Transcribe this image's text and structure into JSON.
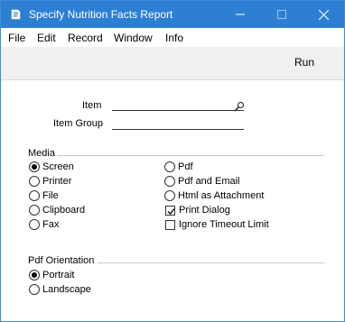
{
  "window": {
    "title": "Specify Nutrition Facts Report"
  },
  "menu": {
    "items": [
      "File",
      "Edit",
      "Record",
      "Window",
      "Info"
    ]
  },
  "toolbar": {
    "run_label": "Run"
  },
  "fields": {
    "item_label": "Item",
    "item_value": "",
    "item_group_label": "Item Group",
    "item_group_value": ""
  },
  "media": {
    "title": "Media",
    "left_options": [
      {
        "label": "Screen",
        "selected": true
      },
      {
        "label": "Printer",
        "selected": false
      },
      {
        "label": "File",
        "selected": false
      },
      {
        "label": "Clipboard",
        "selected": false
      },
      {
        "label": "Fax",
        "selected": false
      }
    ],
    "right_options": [
      {
        "label": "Pdf",
        "selected": false
      },
      {
        "label": "Pdf and Email",
        "selected": false
      },
      {
        "label": "Html as Attachment",
        "selected": false
      }
    ],
    "checkboxes": [
      {
        "label": "Print Dialog",
        "checked": true
      },
      {
        "label": "Ignore Timeout Limit",
        "checked": false
      }
    ]
  },
  "orientation": {
    "title": "Pdf Orientation",
    "options": [
      {
        "label": "Portrait",
        "selected": true
      },
      {
        "label": "Landscape",
        "selected": false
      }
    ]
  },
  "colors": {
    "titlebar": "#2d7fd3",
    "toolbar": "#f0f0f0"
  },
  "icons": {
    "app": "app-icon",
    "minimize": "minimize-icon",
    "maximize": "maximize-icon",
    "close": "close-icon",
    "search": "search-icon"
  }
}
